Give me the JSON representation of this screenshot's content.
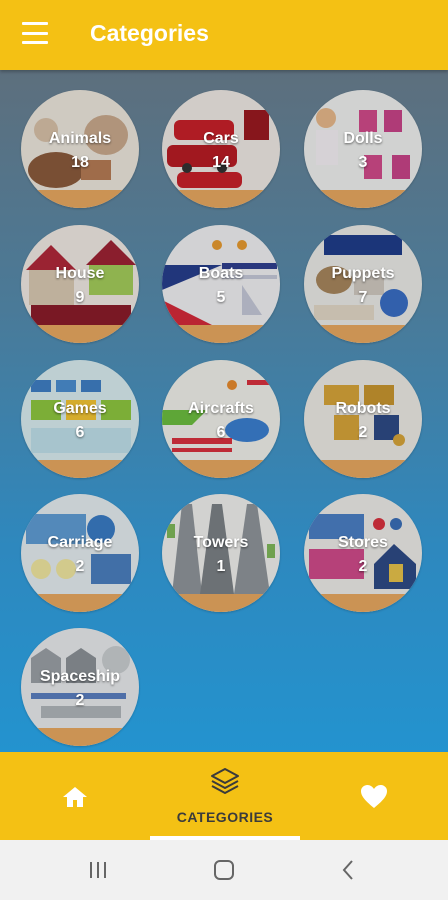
{
  "app": {
    "title": "Categories"
  },
  "colors": {
    "accent": "#f4c114",
    "background_top": "#5d6f7d",
    "background_bottom": "#2393cf",
    "nav_text": "#3b3b3b"
  },
  "categories": [
    {
      "name": "Animals",
      "count": "18"
    },
    {
      "name": "Cars",
      "count": "14"
    },
    {
      "name": "Dolls",
      "count": "3"
    },
    {
      "name": "House",
      "count": "9"
    },
    {
      "name": "Boats",
      "count": "5"
    },
    {
      "name": "Puppets",
      "count": "7"
    },
    {
      "name": "Games",
      "count": "6"
    },
    {
      "name": "Aircrafts",
      "count": "6"
    },
    {
      "name": "Robots",
      "count": "2"
    },
    {
      "name": "Carriage",
      "count": "2"
    },
    {
      "name": "Towers",
      "count": "1"
    },
    {
      "name": "Stores",
      "count": "2"
    },
    {
      "name": "Spaceship",
      "count": "2"
    }
  ],
  "bottom_nav": {
    "home_icon": "home-icon",
    "categories_label": "CATEGORIES",
    "categories_icon": "layers-icon",
    "favorites_icon": "heart-icon"
  },
  "system_nav": {
    "recents_icon": "recents-icon",
    "home_icon": "circle-home-icon",
    "back_icon": "back-chevron-icon"
  }
}
